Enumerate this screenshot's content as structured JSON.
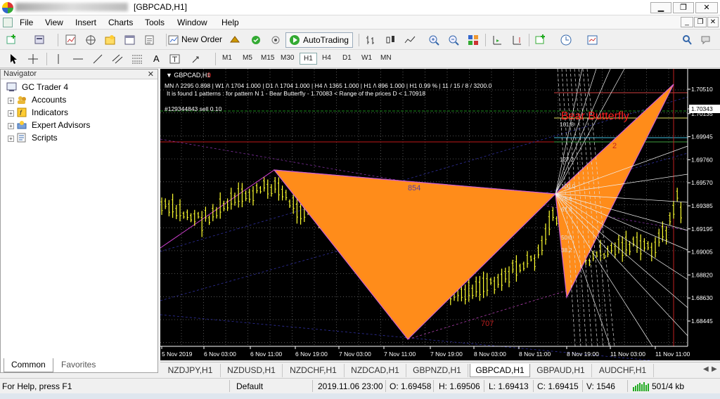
{
  "window": {
    "title": "[GBPCAD,H1]",
    "minimize": "▁",
    "restore": "❐",
    "close": "✕"
  },
  "menu": [
    "File",
    "View",
    "Insert",
    "Charts",
    "Tools",
    "Window",
    "Help"
  ],
  "toolbar": {
    "new_order": "New Order",
    "autotrading": "AutoTrading"
  },
  "timeframes": [
    "M1",
    "M5",
    "M15",
    "M30",
    "H1",
    "H4",
    "D1",
    "W1",
    "MN"
  ],
  "navigator": {
    "title": "Navigator",
    "root": "GC Trader 4",
    "items": [
      "Accounts",
      "Indicators",
      "Expert Advisors",
      "Scripts"
    ],
    "tabs": [
      "Common",
      "Favorites"
    ]
  },
  "chart": {
    "symbol_label": "GBPCAD,H1",
    "info_line": "MN /\\ 2295   0.898 |  W1 /\\ 1704   1.000 |   D1 /\\ 1704   1.000 |   H4 /\\ 1365   1.000 |   H1 /\\ 896   1.000 |   H1  0.99 %  |  11 / 15 / 8 / 3200.0",
    "pattern_line": "It is found 1 patterns :  for pattern N 1 - Bear Butterfly - 1.70083 < Range of the prices D < 1.70918",
    "order_line": "#129344843 sell 0.10",
    "pattern_name": "Bear Butterfly",
    "label_854": "854",
    "label_707": "707",
    "label_2": "2",
    "fib_labels": [
      "161.8",
      "127.2",
      "100.0",
      "78.6",
      "61.8",
      "50.0",
      "38.2"
    ],
    "price_axis": [
      "1.70510",
      "1.70343",
      "1.70135",
      "1.69945",
      "1.69760",
      "1.69570",
      "1.69385",
      "1.69195",
      "1.69005",
      "1.68820",
      "1.68630",
      "1.68445"
    ],
    "current_price": "1.70343",
    "time_axis": [
      "5 Nov 2019",
      "6 Nov 03:00",
      "6 Nov 11:00",
      "6 Nov 19:00",
      "7 Nov 03:00",
      "7 Nov 11:00",
      "7 Nov 19:00",
      "8 Nov 03:00",
      "8 Nov 11:00",
      "8 Nov 19:00",
      "11 Nov 03:00",
      "11 Nov 11:00"
    ]
  },
  "symbol_tabs": [
    "NZDJPY,H1",
    "NZDUSD,H1",
    "NZDCHF,H1",
    "NZDCAD,H1",
    "GBPNZD,H1",
    "GBPCAD,H1",
    "GBPAUD,H1",
    "AUDCHF,H1"
  ],
  "active_symbol_tab": "GBPCAD,H1",
  "status": {
    "help": "For Help, press F1",
    "profile": "Default",
    "datetime": "2019.11.06 23:00",
    "open": "O: 1.69458",
    "high": "H: 1.69506",
    "low": "L: 1.69413",
    "close": "C: 1.69415",
    "volume": "V: 1546",
    "traffic": "501/4 kb"
  }
}
